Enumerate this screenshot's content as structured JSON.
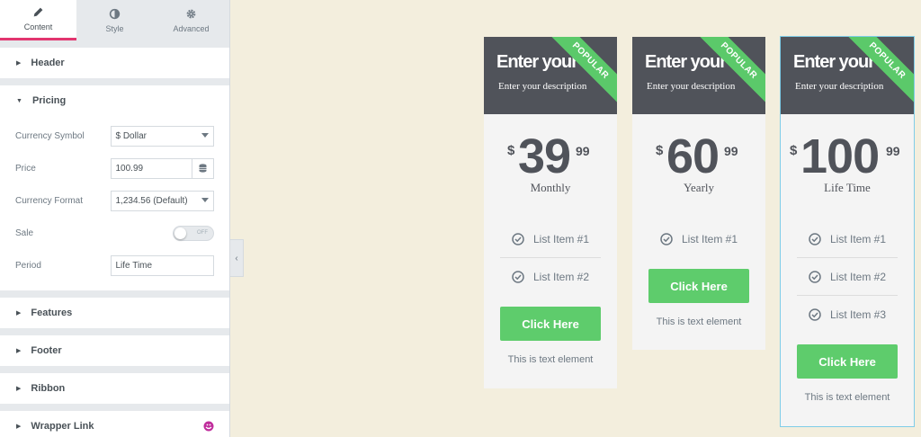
{
  "panel": {
    "tabs": [
      {
        "label": "Content",
        "icon": "pencil-icon"
      },
      {
        "label": "Style",
        "icon": "half-circle-icon"
      },
      {
        "label": "Advanced",
        "icon": "gear-icon"
      }
    ],
    "sections": {
      "header": "Header",
      "pricing": "Pricing",
      "features": "Features",
      "footer": "Footer",
      "ribbon": "Ribbon",
      "wrapper_link": "Wrapper Link"
    },
    "pricing_fields": {
      "currency_symbol_label": "Currency Symbol",
      "currency_symbol_value": "$ Dollar",
      "price_label": "Price",
      "price_value": "100.99",
      "currency_format_label": "Currency Format",
      "currency_format_value": "1,234.56 (Default)",
      "sale_label": "Sale",
      "sale_toggle": "OFF",
      "period_label": "Period",
      "period_value": "Life Time"
    }
  },
  "cards": [
    {
      "title": "Enter your tit",
      "description": "Enter your description",
      "ribbon": "POPULAR",
      "currency": "$",
      "amount": "39",
      "fraction": "99",
      "period": "Monthly",
      "items": [
        "List Item #1",
        "List Item #2"
      ],
      "button": "Click Here",
      "footer": "This is text element"
    },
    {
      "title": "Enter your tit",
      "description": "Enter your description",
      "ribbon": "POPULAR",
      "currency": "$",
      "amount": "60",
      "fraction": "99",
      "period": "Yearly",
      "items": [
        "List Item #1"
      ],
      "button": "Click Here",
      "footer": "This is text element"
    },
    {
      "title": "Enter your tit",
      "description": "Enter your description",
      "ribbon": "POPULAR",
      "currency": "$",
      "amount": "100",
      "fraction": "99",
      "period": "Life Time",
      "items": [
        "List Item #1",
        "List Item #2",
        "List Item #3"
      ],
      "button": "Click Here",
      "footer": "This is text element"
    }
  ],
  "colors": {
    "accent": "#e2356f",
    "card_head": "#50535a",
    "ribbon": "#5bc96a",
    "button": "#5ecc6c",
    "canvas": "#f3eedd"
  }
}
